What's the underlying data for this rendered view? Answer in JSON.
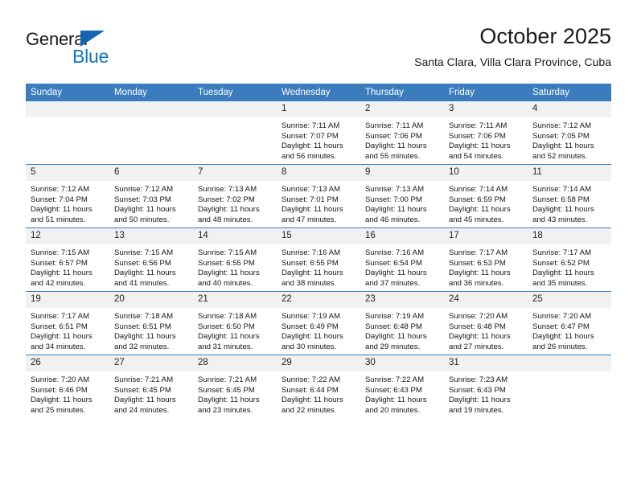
{
  "brand": {
    "name_top": "General",
    "name_bottom": "Blue",
    "accent_color": "#1273c6",
    "triangle_color": "#1565b0"
  },
  "header": {
    "title": "October 2025",
    "subtitle": "Santa Clara, Villa Clara Province, Cuba"
  },
  "calendar": {
    "header_bg": "#3a7cbe",
    "daynum_bg": "#f1f1f1",
    "weekdays": [
      "Sunday",
      "Monday",
      "Tuesday",
      "Wednesday",
      "Thursday",
      "Friday",
      "Saturday"
    ],
    "weeks": [
      [
        {
          "day": "",
          "empty": true,
          "sunrise": "",
          "sunset": "",
          "daylight_1": "",
          "daylight_2": ""
        },
        {
          "day": "",
          "empty": true,
          "sunrise": "",
          "sunset": "",
          "daylight_1": "",
          "daylight_2": ""
        },
        {
          "day": "",
          "empty": true,
          "sunrise": "",
          "sunset": "",
          "daylight_1": "",
          "daylight_2": ""
        },
        {
          "day": "1",
          "empty": false,
          "sunrise": "Sunrise: 7:11 AM",
          "sunset": "Sunset: 7:07 PM",
          "daylight_1": "Daylight: 11 hours",
          "daylight_2": "and 56 minutes."
        },
        {
          "day": "2",
          "empty": false,
          "sunrise": "Sunrise: 7:11 AM",
          "sunset": "Sunset: 7:06 PM",
          "daylight_1": "Daylight: 11 hours",
          "daylight_2": "and 55 minutes."
        },
        {
          "day": "3",
          "empty": false,
          "sunrise": "Sunrise: 7:11 AM",
          "sunset": "Sunset: 7:06 PM",
          "daylight_1": "Daylight: 11 hours",
          "daylight_2": "and 54 minutes."
        },
        {
          "day": "4",
          "empty": false,
          "sunrise": "Sunrise: 7:12 AM",
          "sunset": "Sunset: 7:05 PM",
          "daylight_1": "Daylight: 11 hours",
          "daylight_2": "and 52 minutes."
        }
      ],
      [
        {
          "day": "5",
          "empty": false,
          "sunrise": "Sunrise: 7:12 AM",
          "sunset": "Sunset: 7:04 PM",
          "daylight_1": "Daylight: 11 hours",
          "daylight_2": "and 51 minutes."
        },
        {
          "day": "6",
          "empty": false,
          "sunrise": "Sunrise: 7:12 AM",
          "sunset": "Sunset: 7:03 PM",
          "daylight_1": "Daylight: 11 hours",
          "daylight_2": "and 50 minutes."
        },
        {
          "day": "7",
          "empty": false,
          "sunrise": "Sunrise: 7:13 AM",
          "sunset": "Sunset: 7:02 PM",
          "daylight_1": "Daylight: 11 hours",
          "daylight_2": "and 48 minutes."
        },
        {
          "day": "8",
          "empty": false,
          "sunrise": "Sunrise: 7:13 AM",
          "sunset": "Sunset: 7:01 PM",
          "daylight_1": "Daylight: 11 hours",
          "daylight_2": "and 47 minutes."
        },
        {
          "day": "9",
          "empty": false,
          "sunrise": "Sunrise: 7:13 AM",
          "sunset": "Sunset: 7:00 PM",
          "daylight_1": "Daylight: 11 hours",
          "daylight_2": "and 46 minutes."
        },
        {
          "day": "10",
          "empty": false,
          "sunrise": "Sunrise: 7:14 AM",
          "sunset": "Sunset: 6:59 PM",
          "daylight_1": "Daylight: 11 hours",
          "daylight_2": "and 45 minutes."
        },
        {
          "day": "11",
          "empty": false,
          "sunrise": "Sunrise: 7:14 AM",
          "sunset": "Sunset: 6:58 PM",
          "daylight_1": "Daylight: 11 hours",
          "daylight_2": "and 43 minutes."
        }
      ],
      [
        {
          "day": "12",
          "empty": false,
          "sunrise": "Sunrise: 7:15 AM",
          "sunset": "Sunset: 6:57 PM",
          "daylight_1": "Daylight: 11 hours",
          "daylight_2": "and 42 minutes."
        },
        {
          "day": "13",
          "empty": false,
          "sunrise": "Sunrise: 7:15 AM",
          "sunset": "Sunset: 6:56 PM",
          "daylight_1": "Daylight: 11 hours",
          "daylight_2": "and 41 minutes."
        },
        {
          "day": "14",
          "empty": false,
          "sunrise": "Sunrise: 7:15 AM",
          "sunset": "Sunset: 6:55 PM",
          "daylight_1": "Daylight: 11 hours",
          "daylight_2": "and 40 minutes."
        },
        {
          "day": "15",
          "empty": false,
          "sunrise": "Sunrise: 7:16 AM",
          "sunset": "Sunset: 6:55 PM",
          "daylight_1": "Daylight: 11 hours",
          "daylight_2": "and 38 minutes."
        },
        {
          "day": "16",
          "empty": false,
          "sunrise": "Sunrise: 7:16 AM",
          "sunset": "Sunset: 6:54 PM",
          "daylight_1": "Daylight: 11 hours",
          "daylight_2": "and 37 minutes."
        },
        {
          "day": "17",
          "empty": false,
          "sunrise": "Sunrise: 7:17 AM",
          "sunset": "Sunset: 6:53 PM",
          "daylight_1": "Daylight: 11 hours",
          "daylight_2": "and 36 minutes."
        },
        {
          "day": "18",
          "empty": false,
          "sunrise": "Sunrise: 7:17 AM",
          "sunset": "Sunset: 6:52 PM",
          "daylight_1": "Daylight: 11 hours",
          "daylight_2": "and 35 minutes."
        }
      ],
      [
        {
          "day": "19",
          "empty": false,
          "sunrise": "Sunrise: 7:17 AM",
          "sunset": "Sunset: 6:51 PM",
          "daylight_1": "Daylight: 11 hours",
          "daylight_2": "and 34 minutes."
        },
        {
          "day": "20",
          "empty": false,
          "sunrise": "Sunrise: 7:18 AM",
          "sunset": "Sunset: 6:51 PM",
          "daylight_1": "Daylight: 11 hours",
          "daylight_2": "and 32 minutes."
        },
        {
          "day": "21",
          "empty": false,
          "sunrise": "Sunrise: 7:18 AM",
          "sunset": "Sunset: 6:50 PM",
          "daylight_1": "Daylight: 11 hours",
          "daylight_2": "and 31 minutes."
        },
        {
          "day": "22",
          "empty": false,
          "sunrise": "Sunrise: 7:19 AM",
          "sunset": "Sunset: 6:49 PM",
          "daylight_1": "Daylight: 11 hours",
          "daylight_2": "and 30 minutes."
        },
        {
          "day": "23",
          "empty": false,
          "sunrise": "Sunrise: 7:19 AM",
          "sunset": "Sunset: 6:48 PM",
          "daylight_1": "Daylight: 11 hours",
          "daylight_2": "and 29 minutes."
        },
        {
          "day": "24",
          "empty": false,
          "sunrise": "Sunrise: 7:20 AM",
          "sunset": "Sunset: 6:48 PM",
          "daylight_1": "Daylight: 11 hours",
          "daylight_2": "and 27 minutes."
        },
        {
          "day": "25",
          "empty": false,
          "sunrise": "Sunrise: 7:20 AM",
          "sunset": "Sunset: 6:47 PM",
          "daylight_1": "Daylight: 11 hours",
          "daylight_2": "and 26 minutes."
        }
      ],
      [
        {
          "day": "26",
          "empty": false,
          "sunrise": "Sunrise: 7:20 AM",
          "sunset": "Sunset: 6:46 PM",
          "daylight_1": "Daylight: 11 hours",
          "daylight_2": "and 25 minutes."
        },
        {
          "day": "27",
          "empty": false,
          "sunrise": "Sunrise: 7:21 AM",
          "sunset": "Sunset: 6:45 PM",
          "daylight_1": "Daylight: 11 hours",
          "daylight_2": "and 24 minutes."
        },
        {
          "day": "28",
          "empty": false,
          "sunrise": "Sunrise: 7:21 AM",
          "sunset": "Sunset: 6:45 PM",
          "daylight_1": "Daylight: 11 hours",
          "daylight_2": "and 23 minutes."
        },
        {
          "day": "29",
          "empty": false,
          "sunrise": "Sunrise: 7:22 AM",
          "sunset": "Sunset: 6:44 PM",
          "daylight_1": "Daylight: 11 hours",
          "daylight_2": "and 22 minutes."
        },
        {
          "day": "30",
          "empty": false,
          "sunrise": "Sunrise: 7:22 AM",
          "sunset": "Sunset: 6:43 PM",
          "daylight_1": "Daylight: 11 hours",
          "daylight_2": "and 20 minutes."
        },
        {
          "day": "31",
          "empty": false,
          "sunrise": "Sunrise: 7:23 AM",
          "sunset": "Sunset: 6:43 PM",
          "daylight_1": "Daylight: 11 hours",
          "daylight_2": "and 19 minutes."
        },
        {
          "day": "",
          "empty": true,
          "sunrise": "",
          "sunset": "",
          "daylight_1": "",
          "daylight_2": ""
        }
      ]
    ]
  }
}
